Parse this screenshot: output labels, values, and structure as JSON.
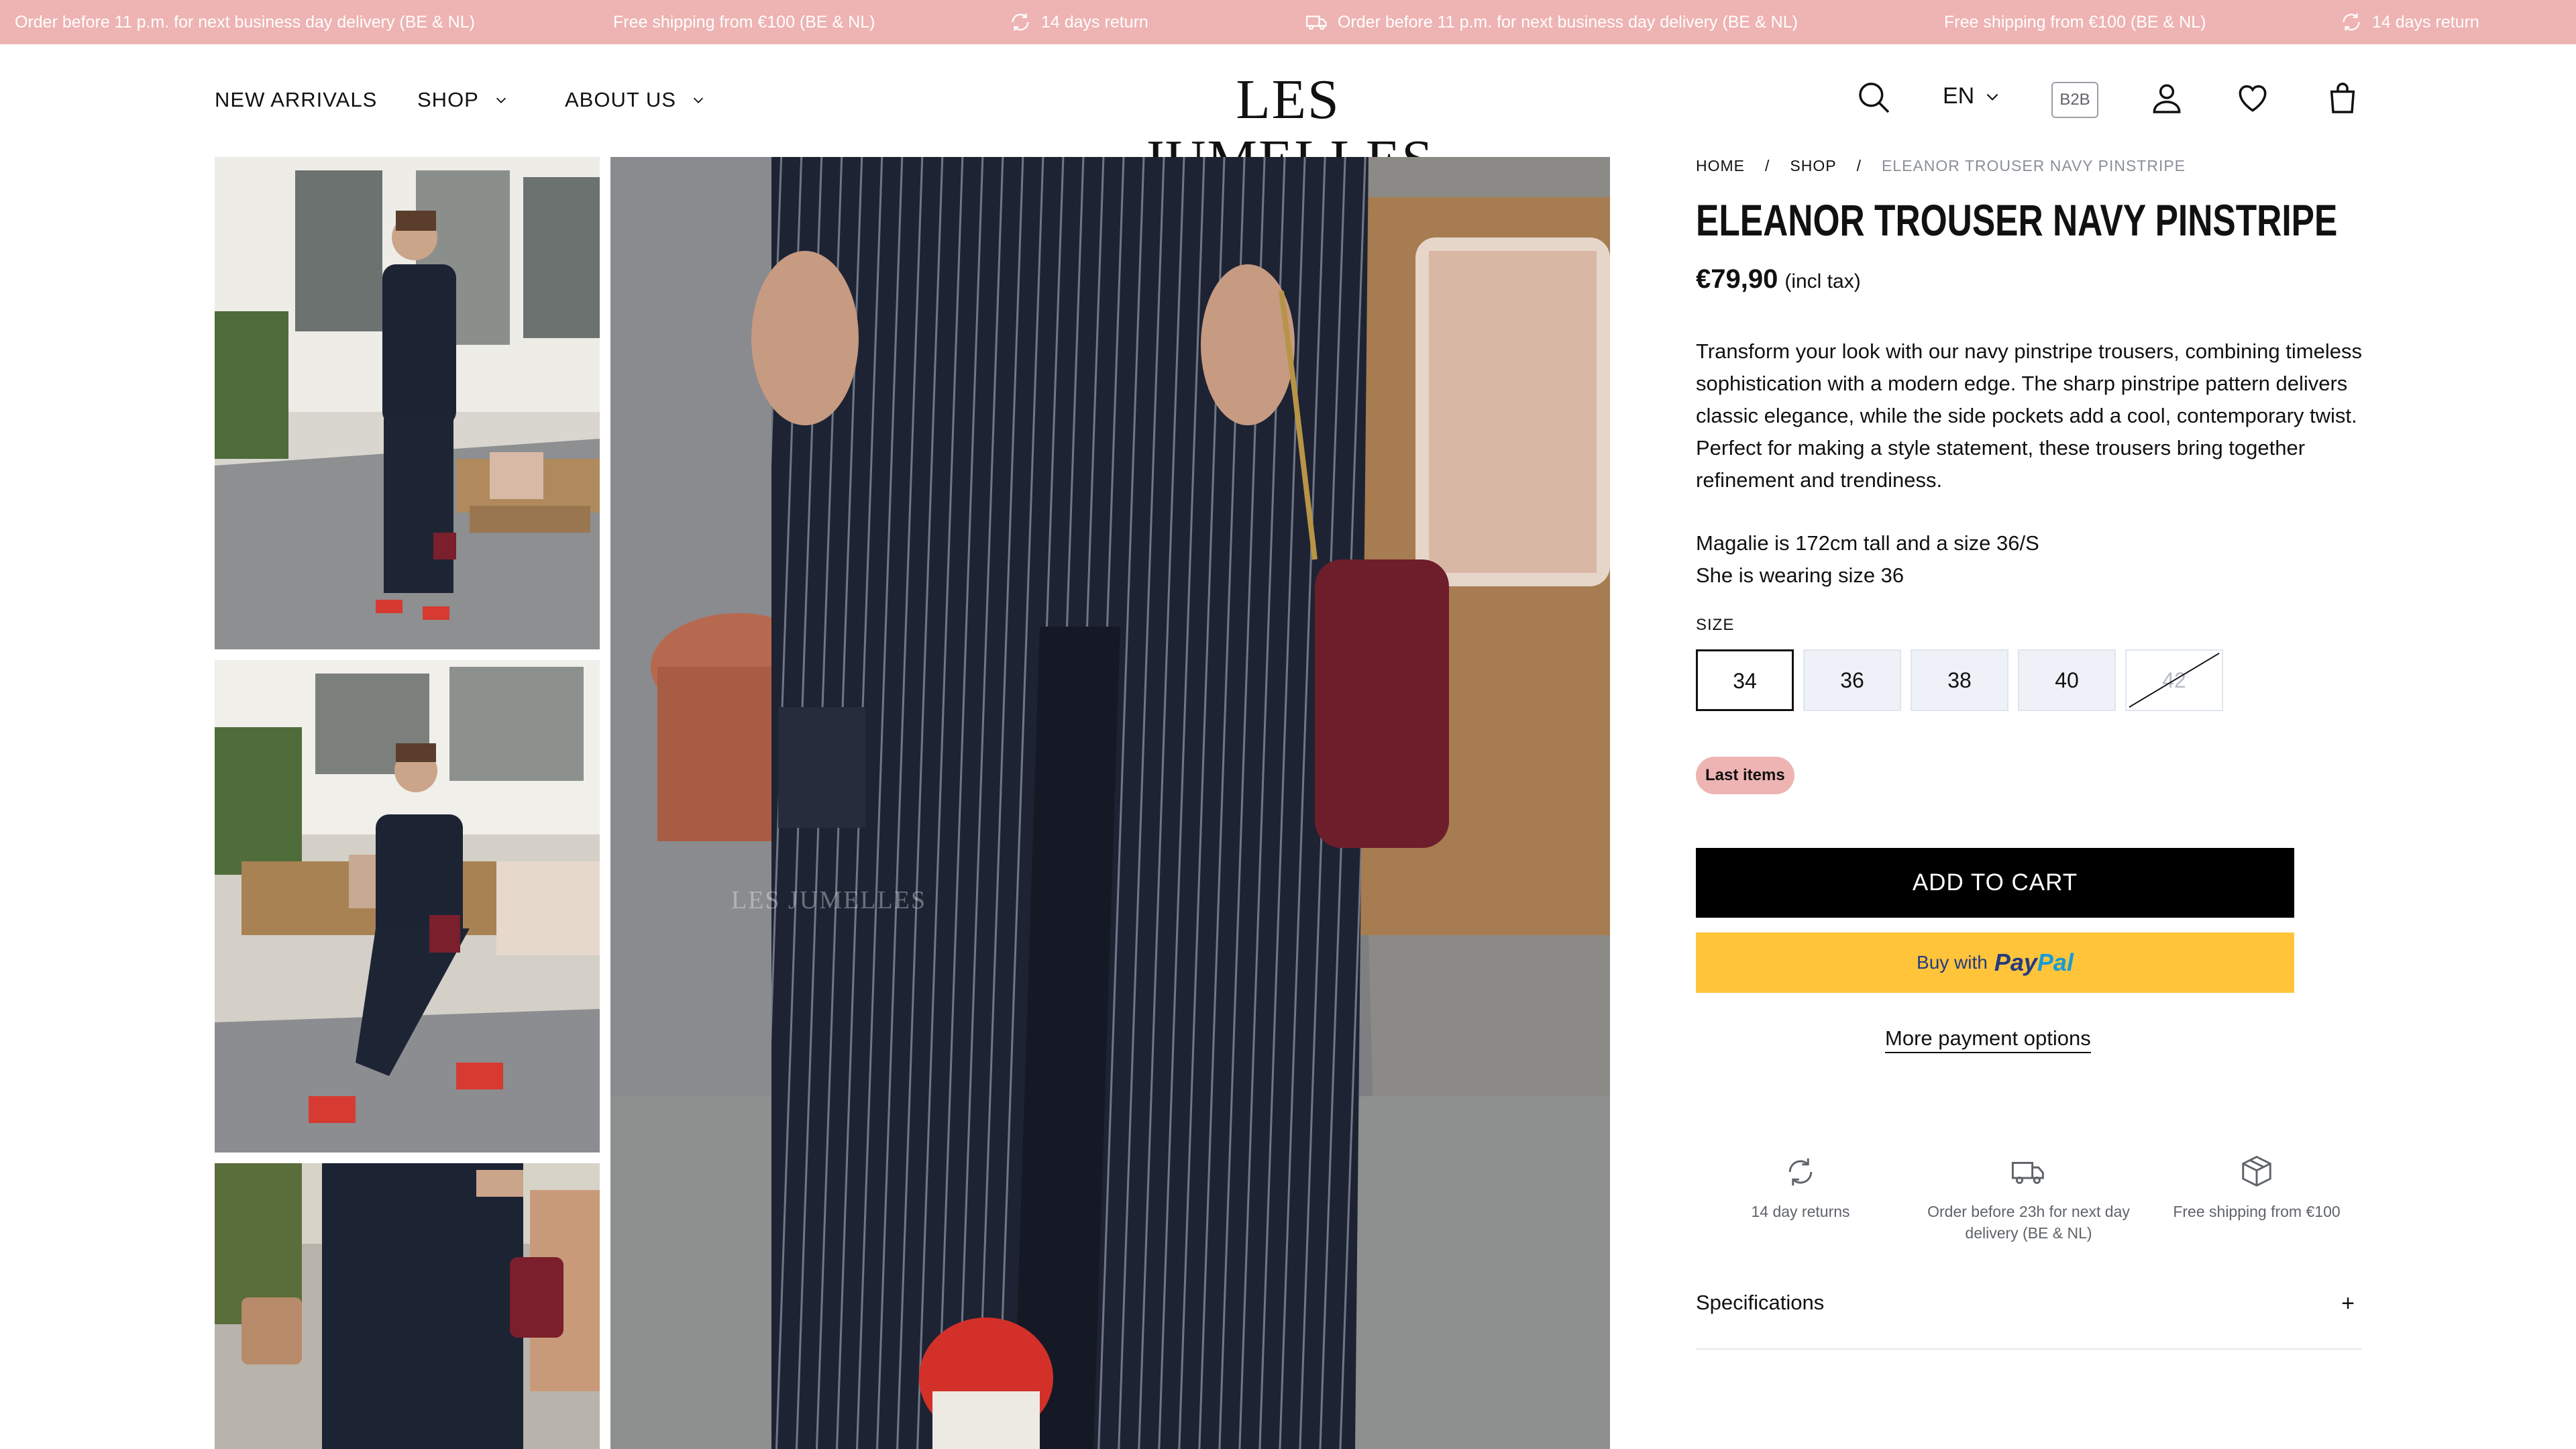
{
  "announcements": [
    "Order before 11 p.m. for next business day delivery (BE & NL)",
    "Free shipping from €100 (BE & NL)",
    "14 days return",
    "Order before 11 p.m. for next business day delivery (BE & NL)",
    "Free shipping from €100 (BE & NL)",
    "14 days return"
  ],
  "nav": {
    "new_arrivals": "NEW ARRIVALS",
    "shop": "SHOP",
    "about": "ABOUT US"
  },
  "logo": "LES JUMELLES",
  "header": {
    "lang": "EN",
    "b2b": "B2B",
    "icons": [
      "search-icon",
      "account-icon",
      "wishlist-icon",
      "cart-icon"
    ]
  },
  "gallery": {
    "watermark": "LES JUMELLES"
  },
  "breadcrumb": [
    "HOME",
    "SHOP",
    "ELEANOR TROUSER NAVY PINSTRIPE"
  ],
  "breadcrumb_sep": "/",
  "product": {
    "title": "ELEANOR TROUSER NAVY PINSTRIPE",
    "price": "€79,90",
    "price_note": "(incl tax)",
    "description": "Transform your look with our navy pinstripe trousers, combining timeless sophistication with a modern edge. The sharp pinstripe pattern delivers classic elegance, while the side pockets add a cool, contemporary twist. Perfect for making a style statement, these trousers bring together refinement and trendiness.",
    "model_line1": "Magalie is 172cm tall and a size 36/S",
    "model_line2": "She is wearing size 36",
    "size_label": "SIZE",
    "sizes": [
      "34",
      "36",
      "38",
      "40",
      "42"
    ],
    "selected_size": "34",
    "unavailable_size": "42",
    "badge": "Last items",
    "add_to_cart": "ADD TO CART",
    "paypal_prefix": "Buy with",
    "paypal_brand_a": "Pay",
    "paypal_brand_b": "Pal",
    "more_payment": "More payment options"
  },
  "usps": [
    "14 day returns",
    "Order before 23h for next day delivery (BE & NL)",
    "Free shipping from €100"
  ],
  "specifications": {
    "label": "Specifications",
    "toggle": "+"
  },
  "colors": {
    "announcement_bg": "#eeb3b3",
    "cart_button": "#000000",
    "paypal_button": "#ffc43a",
    "badge_bg": "#eeb3b3"
  }
}
